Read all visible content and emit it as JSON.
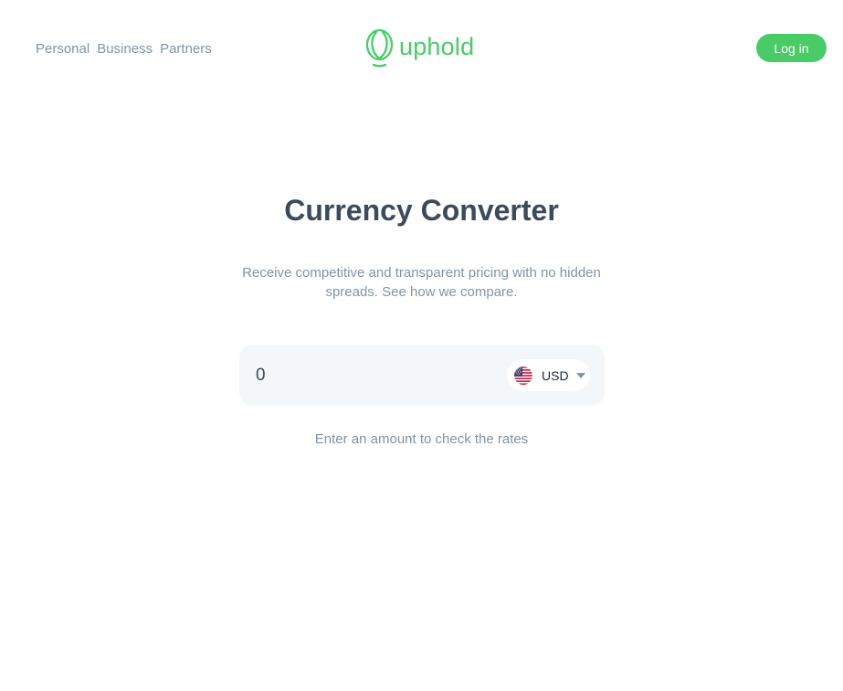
{
  "nav": {
    "items": [
      {
        "label": "Personal"
      },
      {
        "label": "Business"
      },
      {
        "label": "Partners"
      }
    ]
  },
  "brand": {
    "name": "uphold",
    "color": "#49cc68",
    "icon": "uphold-logo-icon"
  },
  "header": {
    "login_label": "Log in"
  },
  "main": {
    "title": "Currency Converter",
    "subtitle": "Receive competitive and transparent pricing with no hidden spreads. See how we compare.",
    "converter": {
      "amount_value": "0",
      "currency_code": "USD",
      "currency_flag_icon": "us-flag-icon",
      "dropdown_icon": "caret-down-icon"
    },
    "hint": "Enter an amount to check the rates"
  },
  "colors": {
    "accent": "#49cc68",
    "text_dark": "#3c4a5b",
    "text_muted": "#8494a5",
    "input_bg": "#f4f7fa"
  }
}
